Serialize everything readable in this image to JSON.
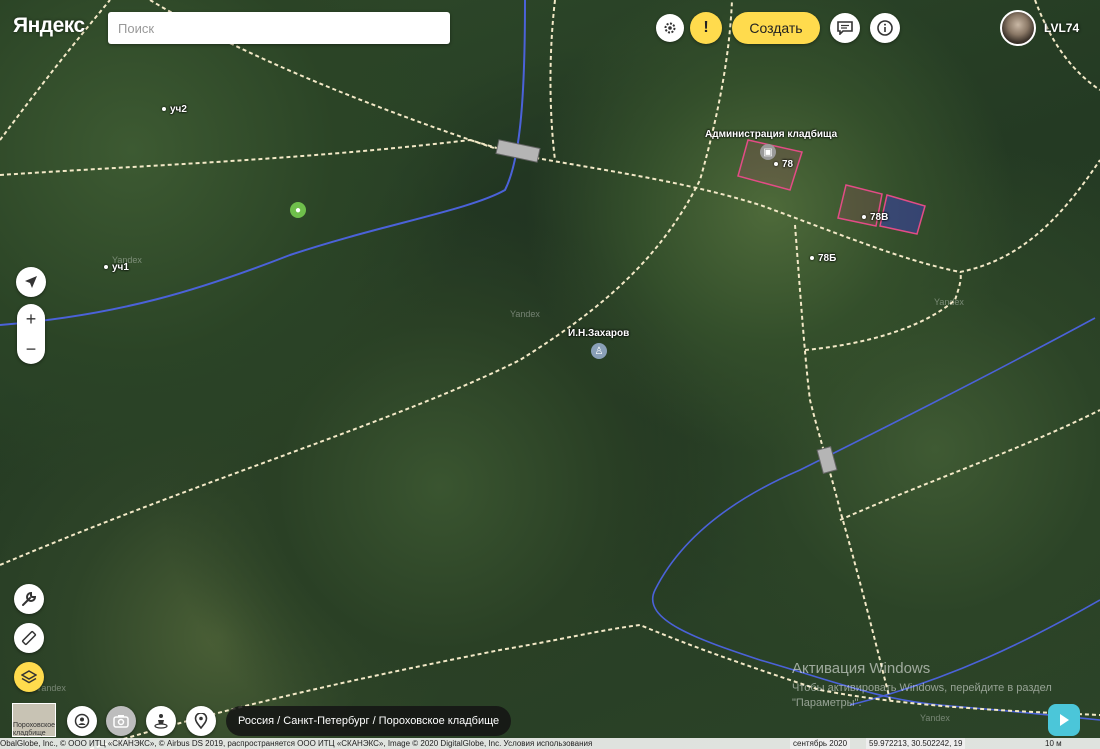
{
  "header": {
    "logo_text": "Яндекс",
    "search_placeholder": "Поиск",
    "create_label": "Создать",
    "username": "LVL74"
  },
  "map": {
    "labels": {
      "uch2": "уч2",
      "uch1": "уч1",
      "admin": "Администрация кладбища",
      "b78": "78",
      "b78v": "78В",
      "b78b": "78Б",
      "zakharov": "И.Н.Захаров"
    },
    "watermark": "Yandex"
  },
  "breadcrumb": "Россия / Санкт-Петербург / Пороховское кладбище",
  "thumbnail_text": "Пороховское кладбище",
  "footer": {
    "copyright": "ObalGlobe, Inc., © ООО ИТЦ «СКАНЭКС», © Airbus DS 2019, распространяется ООО ИТЦ «СКАНЭКС», Image © 2020 DigitalGlobe, Inc. Условия использования",
    "date": "сентябрь 2020",
    "coords": "59.972213, 30.502242, 19",
    "scale": "10 м"
  },
  "activation": {
    "title": "Активация Windows",
    "text": "Чтобы активировать Windows, перейдите в раздел \"Параметры\"."
  },
  "colors": {
    "accent": "#ffdb4d",
    "road": "#f3e9c7",
    "river": "#4b62d9",
    "building": "#e34c86"
  }
}
